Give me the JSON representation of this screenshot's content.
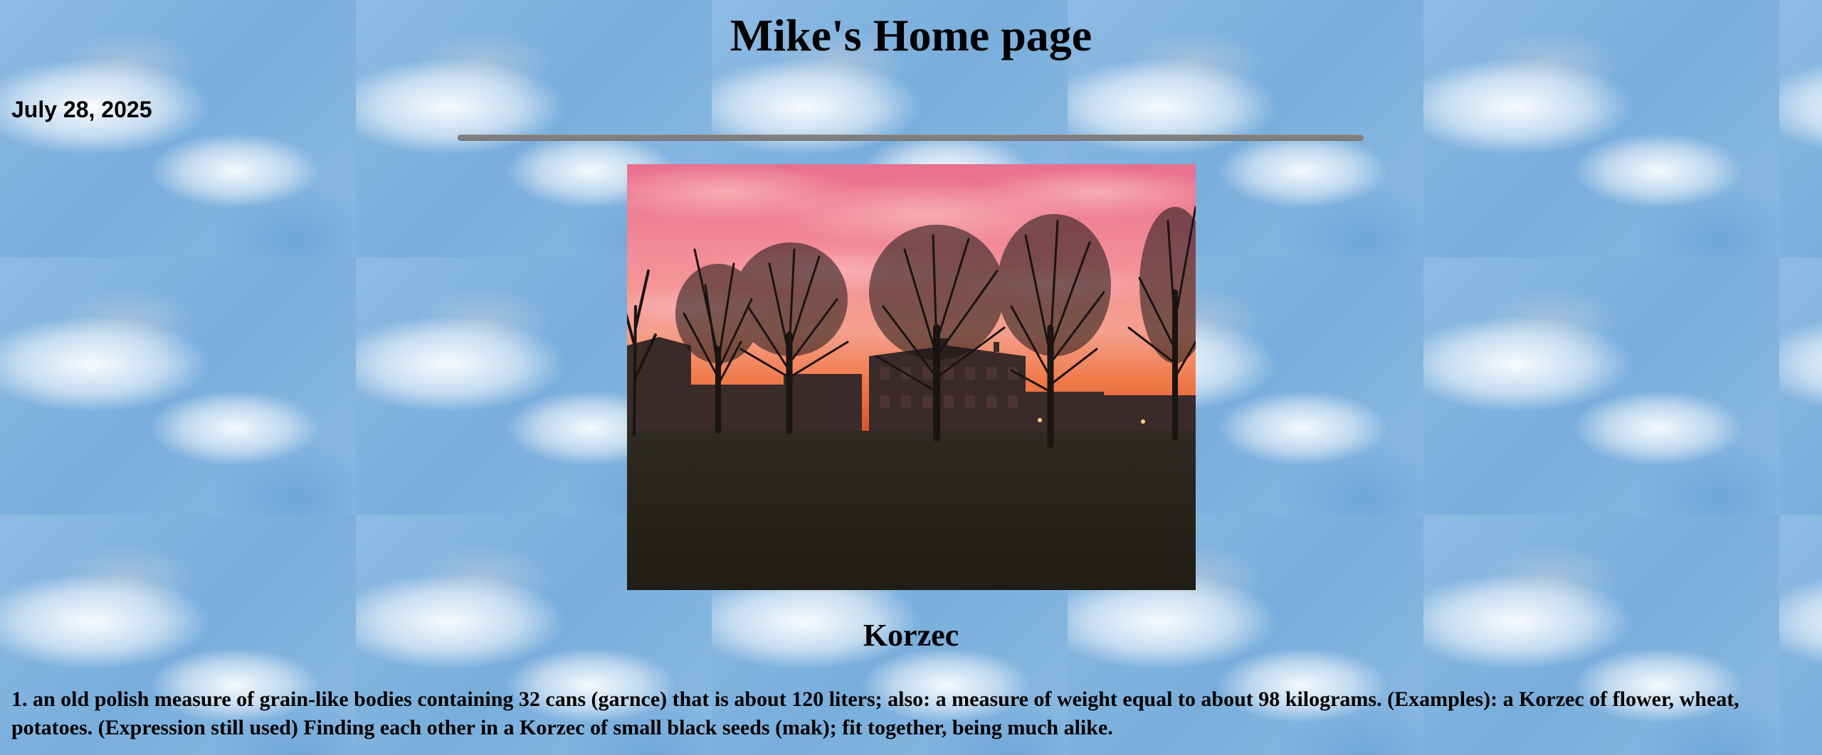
{
  "page": {
    "title": "Mike's Home page",
    "date": "July 28, 2025"
  },
  "photo": {
    "alt": "Sunset over trees and brick buildings",
    "caption": "Korzec"
  },
  "definition": {
    "text": "1. an old polish measure of grain-like bodies containing 32 cans (garnce) that is about 120 liters; also: a measure of weight equal to about 98 kilograms. (Examples): a Korzec of flower, wheat, potatoes. (Expression still used) Finding each other in a Korzec of small black seeds (mak); fit together, being much alike."
  },
  "colors": {
    "sky_blue": "#7fb0dc",
    "divider": "#7f7f7f",
    "sunset_pink": "#f08a9a"
  }
}
